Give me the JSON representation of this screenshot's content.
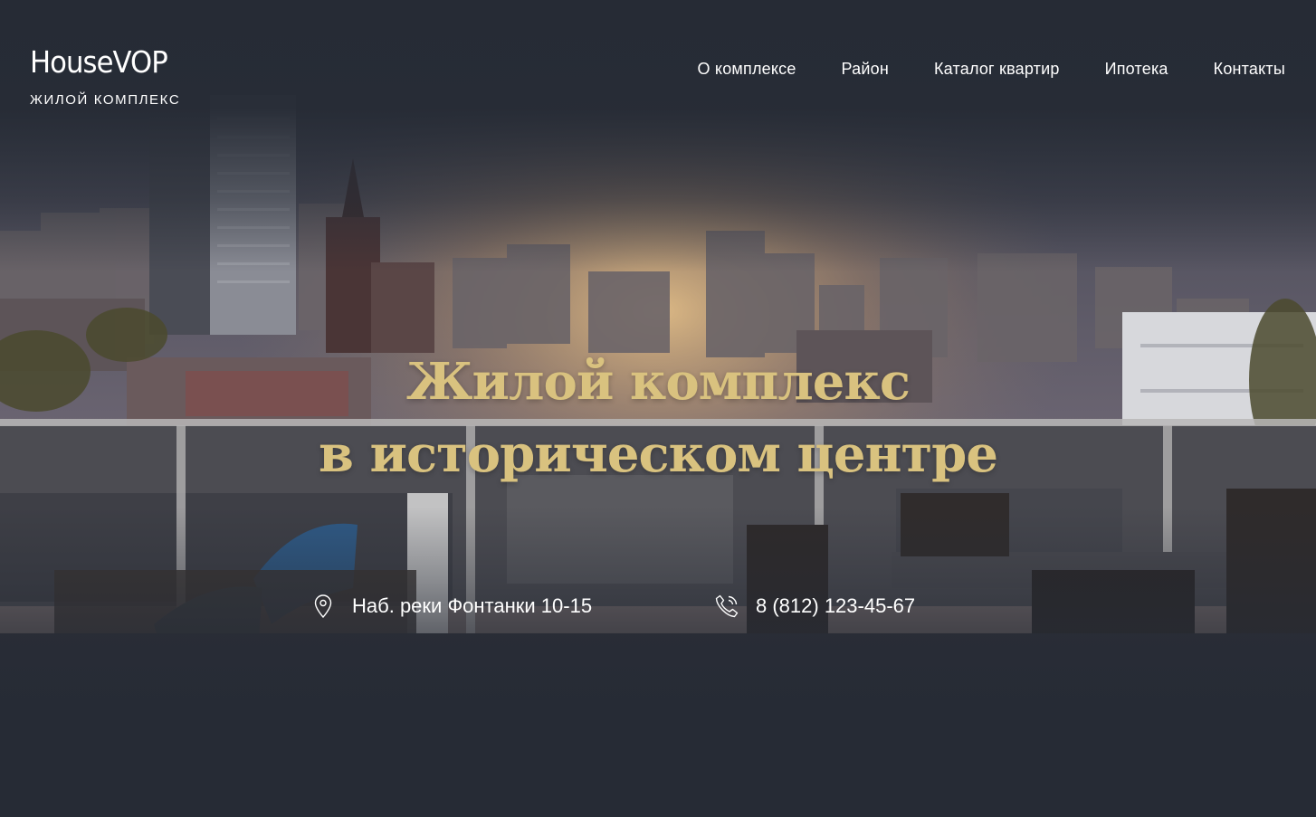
{
  "logo": {
    "title": "HouseVOP",
    "subtitle": "Жилой комплекс"
  },
  "nav": {
    "items": [
      {
        "label": "О комплексе"
      },
      {
        "label": "Район"
      },
      {
        "label": "Каталог квартир"
      },
      {
        "label": "Ипотека"
      },
      {
        "label": "Контакты"
      }
    ]
  },
  "hero": {
    "headline_line1": "Жилой комплекс",
    "headline_line2": "в историческом центре"
  },
  "contacts": {
    "address": "Наб. реки Фонтанки 10-15",
    "address_icon": "map-pin-icon",
    "phone": "8 (812) 123-45-67",
    "phone_icon": "phone-icon"
  },
  "colors": {
    "background": "#262b35",
    "accent_gold": "#d9c27f",
    "text": "#ffffff"
  }
}
